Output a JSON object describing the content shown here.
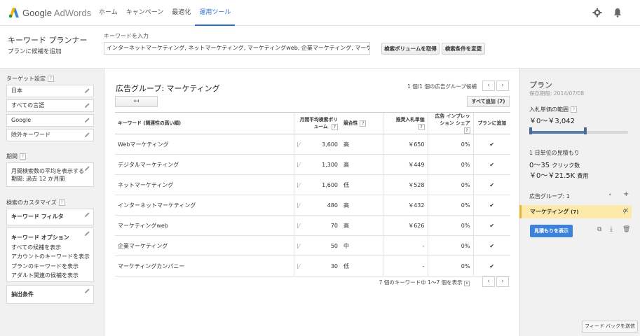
{
  "app": {
    "logo_google": "Google",
    "logo_adwords": "AdWords"
  },
  "nav": [
    "ホーム",
    "キャンペーン",
    "最適化",
    "運用ツール"
  ],
  "header": {
    "title": "キーワード プランナー",
    "subtitle": "プランに候補を追加",
    "keyword_label": "キーワードを入力",
    "keyword_value": "インターネットマーケティング, ネットマーケティング, マーケティングweb, 企業マーケティング, マーケティングカンパニー",
    "btn_volume": "検索ボリュームを取得",
    "btn_change": "検索条件を変更"
  },
  "sidebar": {
    "targeting_title": "ターゲット設定",
    "targeting": [
      "日本",
      "すべての言語",
      "Google",
      "除外キーワード"
    ],
    "period_title": "期間",
    "period_text1": "月間検索数の平均を表示する",
    "period_text2": "期間: 過去 12 か月間",
    "custom_title": "検索のカスタマイズ",
    "filter_label": "キーワード フィルタ",
    "options_label": "キーワード オプション",
    "options": [
      "すべての候補を表示",
      "アカウントのキーワードを表示",
      "プランのキーワードを表示",
      "アダルト関連の候補を表示"
    ],
    "extract_label": "抽出条件"
  },
  "main": {
    "ad_group_title": "広告グループ: マーケティング",
    "pager_top": "1 個/1 個の広告グループ候補",
    "back_symbol": "↤",
    "add_all": "すべて追加 (7)",
    "columns": {
      "keyword": "キーワード (関連性の高い順)",
      "volume": "月間平均検索ボリューム",
      "competition": "競合性",
      "cpc": "推奨入札単価",
      "share": "広告 インプレッション シェア",
      "add": "プランに追加"
    },
    "rows": [
      {
        "keyword": "Webマーケティング",
        "volume": "3,600",
        "competition": "高",
        "cpc": "￥650",
        "share": "0%"
      },
      {
        "keyword": "デジタルマーケティング",
        "volume": "1,300",
        "competition": "高",
        "cpc": "￥449",
        "share": "0%"
      },
      {
        "keyword": "ネットマーケティング",
        "volume": "1,600",
        "competition": "低",
        "cpc": "￥528",
        "share": "0%"
      },
      {
        "keyword": "インターネットマーケティング",
        "volume": "480",
        "competition": "高",
        "cpc": "￥432",
        "share": "0%"
      },
      {
        "keyword": "マーケティングweb",
        "volume": "70",
        "competition": "高",
        "cpc": "￥626",
        "share": "0%"
      },
      {
        "keyword": "企業マーケティング",
        "volume": "50",
        "competition": "中",
        "cpc": "-",
        "share": "0%"
      },
      {
        "keyword": "マーケティングカンパニー",
        "volume": "30",
        "competition": "低",
        "cpc": "-",
        "share": "0%"
      }
    ],
    "pager_bottom": "7 個のキーワード中 1〜7 個を表示"
  },
  "plan": {
    "title": "プラン",
    "saved": "保存期限: 2014/07/08",
    "bid_range_label": "入札単価の範囲",
    "bid_range_value": "￥0〜￥3,042",
    "estimate_label": "1 日単位の見積もり",
    "clicks_value": "0〜35",
    "clicks_unit": "クリック数",
    "cost_value": "￥0〜￥21.5K",
    "cost_unit": "費用",
    "ad_group_label": "広告グループ: 1",
    "group_name": "マーケティング",
    "group_count": "(7)",
    "estimate_btn": "見積もりを表示"
  },
  "feedback": "フィード バックを送信",
  "colors": {
    "accent": "#2a6fd0",
    "check": "#3a9a3a",
    "highlight": "#fde9a9",
    "button_blue": "#3b82dc"
  }
}
